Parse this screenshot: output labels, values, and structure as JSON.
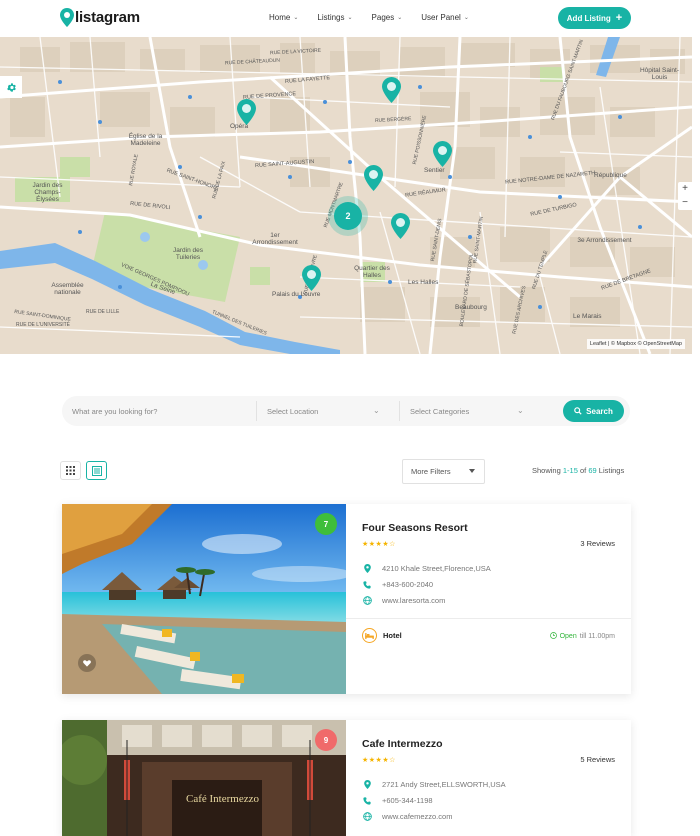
{
  "header": {
    "logo_text": "listagram",
    "nav": [
      {
        "label": "Home"
      },
      {
        "label": "Listings"
      },
      {
        "label": "Pages"
      },
      {
        "label": "User Panel"
      }
    ],
    "add_listing": "Add Listing",
    "add_listing_icon": "+",
    "accent": "#18b3a5"
  },
  "map": {
    "cluster_count": "2",
    "attribution": "Leaflet | © Mapbox © OpenStreetMap",
    "zoom_in": "+",
    "zoom_out": "−",
    "labels": {
      "opera": "Opéra",
      "sentier": "Sentier",
      "republique": "République",
      "arrondissement_1": "1er Arrondissement",
      "arrondissement_3": "3e Arrondissement",
      "jardin": "Jardin des Tuileries",
      "louvre": "Palais du Louvre",
      "halles": "Les Halles",
      "quartier": "Quartier des Halles",
      "beaubourg": "Beaubourg",
      "marais": "Le Marais",
      "seine": "La Seine",
      "hopital": "Hôpital Saint-Louis",
      "jardin_elysees": "Jardin des Champs-Élysées",
      "assemblee": "Assemblée nationale",
      "madeleine": "Église de la Madeleine",
      "rue_rivoli": "RUE DE RIVOLI",
      "rue_faubourg": "RUE DU FAUBOURG SAINT-MARTIN",
      "rue_saint_honore": "RUE SAINT-HONORÉ",
      "rue_lafayette": "RUE LA FAYETTE",
      "boulevard_sebastopol": "BOULEVARD DE SÉBASTOPOL",
      "rue_reaumur": "RUE RÉAUMUR",
      "voie_pompidou": "VOIE GEORGES POMPIDOU",
      "rue_universite": "RUE DE L'UNIVERSITÉ",
      "rue_lille": "RUE DE LILLE",
      "rue_turbigo": "RUE DE TURBIGO",
      "rue_saint_augustin": "RUE SAINT-AUGUSTIN",
      "rue_de_provence": "RUE DE PROVENCE",
      "rue_notre_dame": "RUE NOTRE-DAME DE NAZARETH",
      "rue_bretagne": "RUE DE BRETAGNE",
      "rue_saint_dominique": "RUE SAINT-DOMINIQUE",
      "rue_du_louvre": "RUE DU LOUVRE",
      "rue_montmartre": "RUE MONTMARTRE",
      "rue_de_la_paix": "RUE DE LA PAIX",
      "rue_des_archives": "RUE DES ARCHIVES",
      "rue_du_temple": "RUE DU TEMPLE",
      "tunnel": "TUNNEL DES TUILERIES",
      "rue_royale": "RUE ROYALE",
      "rue_victoire": "RUE DE LA VICTOIRE",
      "rue_chateaudun": "RUE DE CHÂTEAUDUN",
      "rue_bergere": "RUE BERGÈRE",
      "rue_poissonniere": "RUE POISSONNIÈRE",
      "rue_saint_denis": "RUE SAINT-DENIS",
      "rue_saint_martin": "RUE SAINT-MARTIN"
    }
  },
  "search": {
    "keyword_placeholder": "What are you looking for?",
    "location_placeholder": "Select Location",
    "category_placeholder": "Select Categories",
    "button": "Search"
  },
  "toolbar": {
    "filters": "More Filters",
    "showing_prefix": "Showing",
    "showing_range": "1-15",
    "showing_of": "of",
    "showing_total": "69",
    "showing_suffix": "Listings"
  },
  "listings": [
    {
      "rating": "7",
      "rating_color": "#3fbe3a",
      "title": "Four Seasons Resort",
      "stars": "★★★★☆",
      "reviews": "3 Reviews",
      "address": "4210 Khale Street,Florence,USA",
      "phone": "+843-600-2040",
      "website": "www.laresorta.com",
      "category": "Hotel",
      "open_label": "Open",
      "hours": "till 11.00pm"
    },
    {
      "rating": "9",
      "rating_color": "#f06a6a",
      "title": "Cafe Intermezzo",
      "stars": "★★★★☆",
      "reviews": "5 Reviews",
      "address": "2721 Andy Street,ELLSWORTH,USA",
      "phone": "+605-344-1198",
      "website": "www.cafemezzo.com",
      "sign_text": "Café Intermezzo"
    }
  ]
}
